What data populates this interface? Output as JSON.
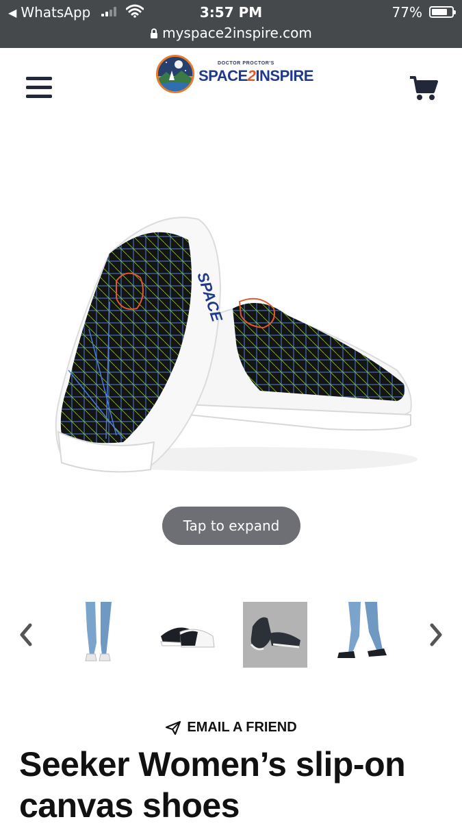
{
  "status_bar": {
    "back_app": "WhatsApp",
    "time": "3:57 PM",
    "battery": "77%",
    "battery_level": 0.77,
    "url": "myspace2inspire.com"
  },
  "header": {
    "logo_small": "DOCTOR PROCTOR'S",
    "logo_part1": "SPACE",
    "logo_part2": "2",
    "logo_part3": "INSPIRE"
  },
  "gallery": {
    "expand_label": "Tap to expand",
    "thumbnails": [
      "model-front",
      "shoes-side",
      "shoes-angle",
      "model-side"
    ],
    "selected_index": 2
  },
  "product": {
    "email_label": "EMAIL A FRIEND",
    "title": "Seeker Women’s slip-on canvas shoes"
  },
  "colors": {
    "status_bg": "#46494c",
    "icon_dark": "#22273a",
    "button_gray": "#6d6f74",
    "shoe_pattern_blue": "#4a7fd4",
    "shoe_pattern_green": "#8fbf4a",
    "shoe_pattern_orange": "#e0582b"
  }
}
